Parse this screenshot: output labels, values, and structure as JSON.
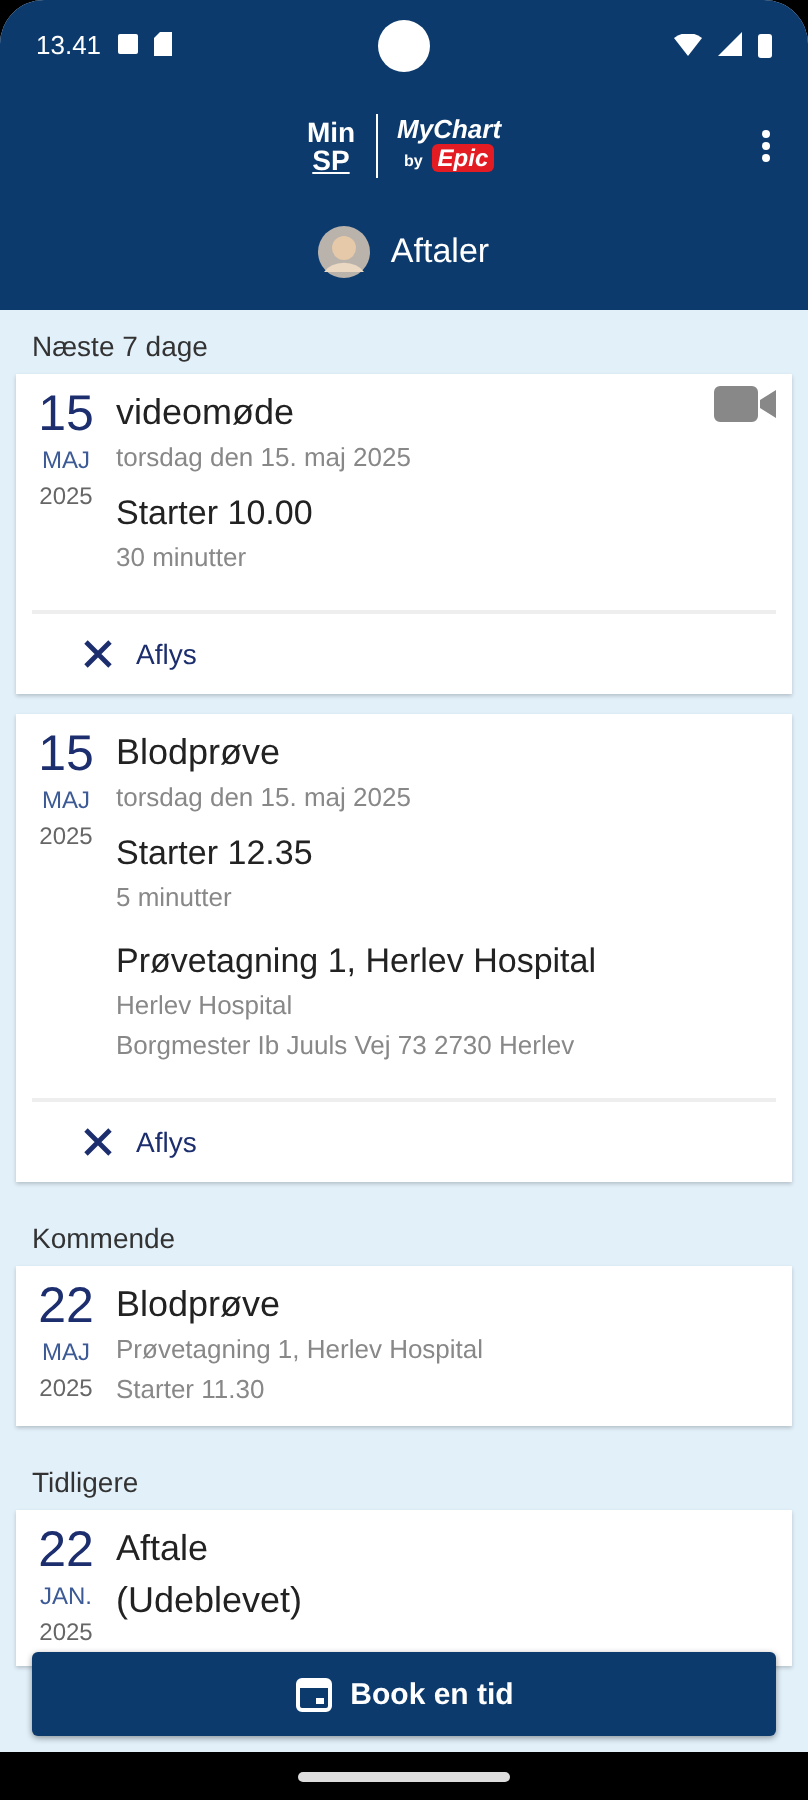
{
  "status_bar": {
    "time": "13.41"
  },
  "header": {
    "logo": {
      "line_1": "Min",
      "line_2": "SP",
      "brand": "MyChart",
      "by": "by",
      "vendor": "Epic"
    },
    "title": "Aftaler"
  },
  "sections": [
    {
      "heading": "Næste 7 dage",
      "appointments": [
        {
          "day": "15",
          "month": "MAJ",
          "year": "2025",
          "title": "videomøde",
          "date": "torsdag den 15. maj 2025",
          "start": "Starter 10.00",
          "duration": "30 minutter",
          "video": true,
          "cancel": "Aflys"
        },
        {
          "day": "15",
          "month": "MAJ",
          "year": "2025",
          "title": "Blodprøve",
          "date": "torsdag den 15. maj 2025",
          "start": "Starter 12.35",
          "duration": "5 minutter",
          "place": "Prøvetagning 1, Herlev Hospital",
          "place_lines": [
            "Herlev Hospital",
            "Borgmester Ib Juuls Vej 73 2730 Herlev"
          ],
          "video": false,
          "cancel": "Aflys"
        }
      ]
    },
    {
      "heading": "Kommende",
      "appointments": [
        {
          "day": "22",
          "month": "MAJ",
          "year": "2025",
          "title": "Blodprøve",
          "compact_lines": [
            "Prøvetagning 1, Herlev Hospital",
            "Starter 11.30"
          ],
          "video": false
        }
      ]
    },
    {
      "heading": "Tidligere",
      "appointments": [
        {
          "day": "22",
          "month": "JAN.",
          "year": "2025",
          "title": "Aftale",
          "note": "(Udeblevet)",
          "video": false
        }
      ]
    }
  ],
  "book_button": "Book en tid"
}
